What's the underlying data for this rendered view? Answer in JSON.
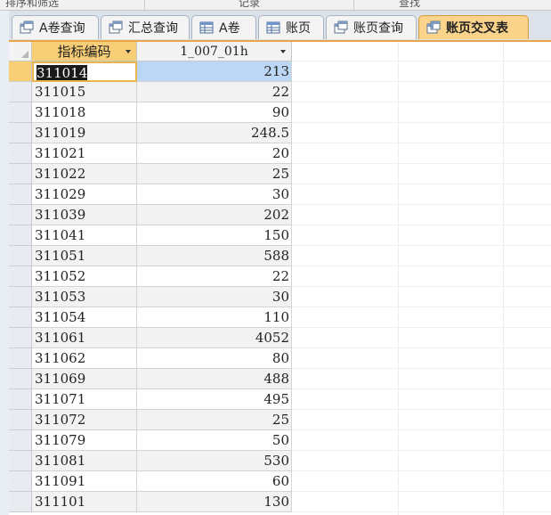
{
  "ribbon": {
    "groups": [
      "排序和筛选",
      "记录",
      "查找"
    ]
  },
  "tabs": [
    {
      "label": "A卷查询",
      "icon": "query-icon",
      "active": false
    },
    {
      "label": "汇总查询",
      "icon": "query-icon",
      "active": false
    },
    {
      "label": "A卷",
      "icon": "table-icon",
      "active": false
    },
    {
      "label": "账页",
      "icon": "table-icon",
      "active": false
    },
    {
      "label": "账页查询",
      "icon": "query-icon",
      "active": false
    },
    {
      "label": "账页交叉表",
      "icon": "crosstab-query-icon",
      "active": true
    }
  ],
  "datasheet": {
    "columns": [
      "指标编码",
      "1_007_01h"
    ],
    "rows": [
      [
        "311014",
        "213"
      ],
      [
        "311015",
        "22"
      ],
      [
        "311018",
        "90"
      ],
      [
        "311019",
        "248.5"
      ],
      [
        "311021",
        "20"
      ],
      [
        "311022",
        "25"
      ],
      [
        "311029",
        "30"
      ],
      [
        "311039",
        "202"
      ],
      [
        "311041",
        "150"
      ],
      [
        "311051",
        "588"
      ],
      [
        "311052",
        "22"
      ],
      [
        "311053",
        "30"
      ],
      [
        "311054",
        "110"
      ],
      [
        "311061",
        "4052"
      ],
      [
        "311062",
        "80"
      ],
      [
        "311069",
        "488"
      ],
      [
        "311071",
        "495"
      ],
      [
        "311072",
        "25"
      ],
      [
        "311079",
        "50"
      ],
      [
        "311081",
        "530"
      ],
      [
        "311091",
        "60"
      ],
      [
        "311101",
        "130"
      ]
    ]
  },
  "colors": {
    "active_tab": "#fbd38a",
    "selected_header": "#f8cf77",
    "selected_cell": "#bcd7f5",
    "tab_strip": "#dbe2ea"
  }
}
